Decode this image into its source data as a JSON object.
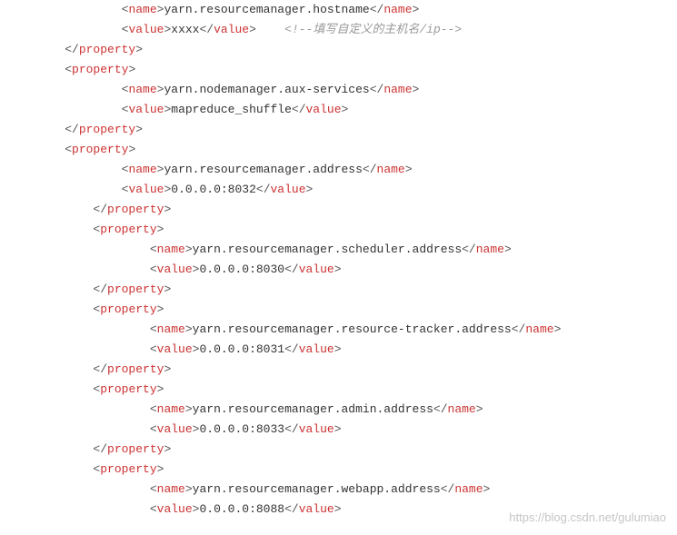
{
  "lines": [
    {
      "indent": 3,
      "kind": "tag",
      "tag": "name",
      "text": "yarn.resourcemanager.hostname",
      "close_same": true
    },
    {
      "indent": 3,
      "kind": "tag",
      "tag": "value",
      "text": "xxxx",
      "close_same": true,
      "trailing_comment": "<!--填写自定义的主机名/ip-->"
    },
    {
      "indent": 1,
      "kind": "close",
      "tag": "property"
    },
    {
      "indent": 1,
      "kind": "open",
      "tag": "property"
    },
    {
      "indent": 3,
      "kind": "tag",
      "tag": "name",
      "text": "yarn.nodemanager.aux-services",
      "close_same": true
    },
    {
      "indent": 3,
      "kind": "tag",
      "tag": "value",
      "text": "mapreduce_shuffle",
      "close_same": true
    },
    {
      "indent": 1,
      "kind": "close",
      "tag": "property"
    },
    {
      "indent": 1,
      "kind": "open",
      "tag": "property"
    },
    {
      "indent": 3,
      "kind": "tag",
      "tag": "name",
      "text": "yarn.resourcemanager.address",
      "close_same": true
    },
    {
      "indent": 3,
      "kind": "tag",
      "tag": "value",
      "text": "0.0.0.0:8032",
      "close_same": true
    },
    {
      "indent": 2,
      "kind": "close",
      "tag": "property"
    },
    {
      "indent": 2,
      "kind": "open",
      "tag": "property"
    },
    {
      "indent": 4,
      "kind": "tag",
      "tag": "name",
      "text": "yarn.resourcemanager.scheduler.address",
      "close_same": true
    },
    {
      "indent": 4,
      "kind": "tag",
      "tag": "value",
      "text": "0.0.0.0:8030",
      "close_same": true
    },
    {
      "indent": 2,
      "kind": "close",
      "tag": "property"
    },
    {
      "indent": 2,
      "kind": "open",
      "tag": "property"
    },
    {
      "indent": 4,
      "kind": "tag",
      "tag": "name",
      "text": "yarn.resourcemanager.resource-tracker.address",
      "close_same": true
    },
    {
      "indent": 4,
      "kind": "tag",
      "tag": "value",
      "text": "0.0.0.0:8031",
      "close_same": true
    },
    {
      "indent": 2,
      "kind": "close",
      "tag": "property"
    },
    {
      "indent": 2,
      "kind": "open",
      "tag": "property"
    },
    {
      "indent": 4,
      "kind": "tag",
      "tag": "name",
      "text": "yarn.resourcemanager.admin.address",
      "close_same": true
    },
    {
      "indent": 4,
      "kind": "tag",
      "tag": "value",
      "text": "0.0.0.0:8033",
      "close_same": true
    },
    {
      "indent": 2,
      "kind": "close",
      "tag": "property"
    },
    {
      "indent": 2,
      "kind": "open",
      "tag": "property"
    },
    {
      "indent": 4,
      "kind": "tag",
      "tag": "name",
      "text": "yarn.resourcemanager.webapp.address",
      "close_same": true
    },
    {
      "indent": 4,
      "kind": "tag",
      "tag": "value",
      "text": "0.0.0.0:8088",
      "close_same": true
    }
  ],
  "watermark": "https://blog.csdn.net/gulumiao"
}
